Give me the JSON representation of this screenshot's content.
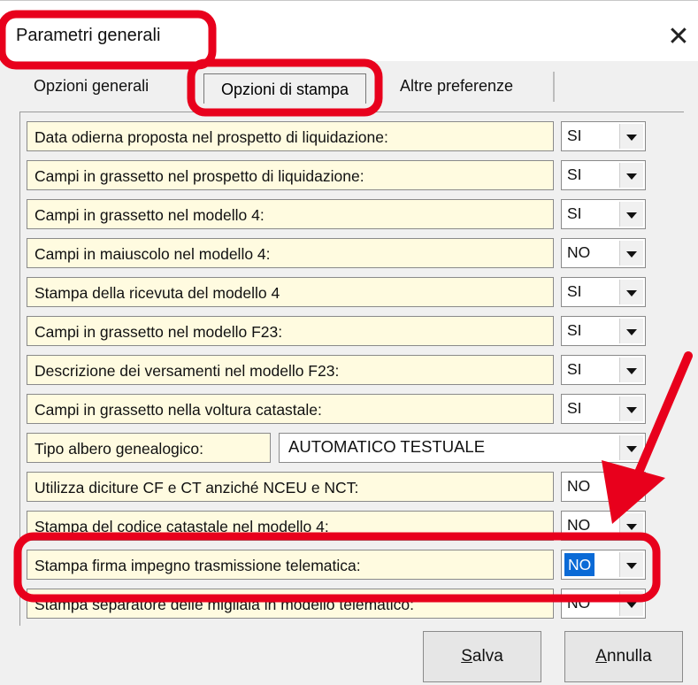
{
  "window": {
    "title": "Parametri generali",
    "close_glyph": "✕"
  },
  "tabs": [
    {
      "label": "Opzioni generali"
    },
    {
      "label": "Opzioni di stampa"
    },
    {
      "label": "Altre preferenze"
    }
  ],
  "options": [
    {
      "label": "Data odierna proposta nel prospetto di liquidazione:",
      "value": "SI"
    },
    {
      "label": "Campi in grassetto nel prospetto di liquidazione:",
      "value": "SI"
    },
    {
      "label": "Campi in grassetto nel modello 4:",
      "value": "SI"
    },
    {
      "label": "Campi in maiuscolo nel modello 4:",
      "value": "NO"
    },
    {
      "label": "Stampa della ricevuta del modello 4",
      "value": "SI"
    },
    {
      "label": "Campi in grassetto nel modello F23:",
      "value": "SI"
    },
    {
      "label": "Descrizione dei versamenti nel modello F23:",
      "value": "SI"
    },
    {
      "label": "Campi in grassetto nella voltura catastale:",
      "value": "SI"
    },
    {
      "label": "Tipo albero genealogico:",
      "value": "AUTOMATICO TESTUALE"
    },
    {
      "label": "Utilizza diciture CF e CT anziché NCEU e NCT:",
      "value": "NO"
    },
    {
      "label": "Stampa del codice catastale nel modello 4:",
      "value": "NO"
    },
    {
      "label": "Stampa firma impegno trasmissione telematica:",
      "value": "NO"
    },
    {
      "label": "Stampa separatore delle migliaia in modello telematico:",
      "value": "NO"
    }
  ],
  "buttons": {
    "save": {
      "accel": "S",
      "rest": "alva"
    },
    "cancel": {
      "accel": "A",
      "rest": "nnulla"
    }
  },
  "annotation_color": "#e8001c",
  "colors": {
    "label_bg": "#fffbe0",
    "selection": "#0a6ad6"
  }
}
